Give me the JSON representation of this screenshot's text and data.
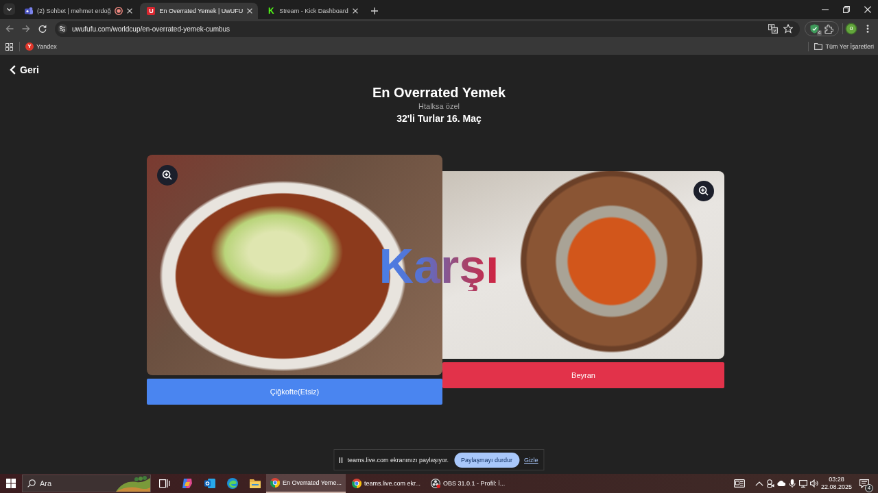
{
  "browser": {
    "tabs": [
      {
        "title": "(2) Sohbet | mehmet erdoğ",
        "kind": "chat",
        "selected": false,
        "recording": true
      },
      {
        "title": "En Overrated Yemek | UwUFU",
        "kind": "tile",
        "logo": "U",
        "color": "#d8262f",
        "selected": true,
        "recording": false
      },
      {
        "title": "Stream - Kick Dashboard",
        "kind": "glyph",
        "logo": "K",
        "color": "#53fc18",
        "selected": false,
        "recording": false
      }
    ],
    "address": "uwufufu.com/worldcup/en-overrated-yemek-cumbus",
    "extension_badge": "4",
    "profile_initial": "o",
    "bookmarks": [
      {
        "label": "Yandex",
        "logo": "Y"
      }
    ],
    "all_bookmarks": "Tüm Yer İşaretleri"
  },
  "page": {
    "back": "Geri",
    "title": "En Overrated Yemek",
    "subtitle": "Htalksa özel",
    "round": "32'li Turlar 16. Maç",
    "choices": [
      {
        "label": "Çiğkofte(Etsiz)",
        "color": "#4a85f0"
      },
      {
        "label": "Beyran",
        "color": "#e2324a"
      }
    ],
    "versus": "Karşı"
  },
  "share_bar": {
    "message": "teams.live.com ekranınızı paylaşıyor.",
    "stop_button": "Paylaşmayı durdur",
    "hide_link": "Gizle"
  },
  "taskbar": {
    "search_placeholder": "Ara",
    "windows": [
      {
        "label": "En Overrated Yeme...",
        "kind": "browser",
        "selected": true
      },
      {
        "label": "teams.live.com ekr...",
        "kind": "browser",
        "selected": false
      },
      {
        "label": "OBS 31.0.1 - Profil: İ...",
        "kind": "recorder",
        "selected": false
      }
    ],
    "time": "03:28",
    "date": "22.08.2025",
    "notification_count": "4"
  }
}
